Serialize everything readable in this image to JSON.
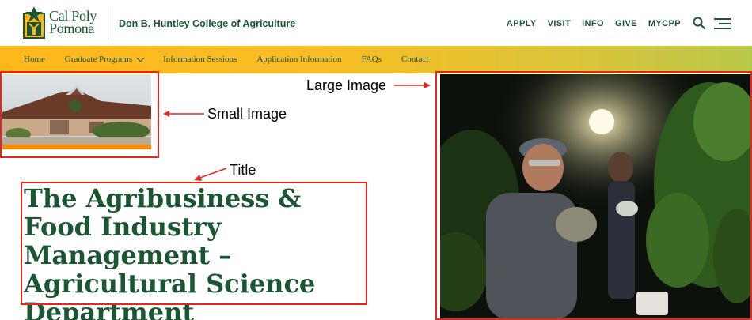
{
  "header": {
    "logo_line1": "Cal Poly",
    "logo_line2": "Pomona",
    "college_name": "Don B. Huntley College of Agriculture",
    "util_links": [
      "APPLY",
      "VISIT",
      "INFO",
      "GIVE",
      "MYCPP"
    ],
    "icons": [
      "search-icon",
      "menu-icon"
    ]
  },
  "nav": {
    "items": [
      "Home",
      "Graduate Programs",
      "Information Sessions",
      "Application Information",
      "FAQs",
      "Contact"
    ]
  },
  "title": "The Agribusiness & Food Industry Management – Agricultural Science Department",
  "annotations": {
    "small_image": "Small Image",
    "large_image": "Large Image",
    "title": "Title"
  },
  "colors": {
    "brand_green": "#1a5632",
    "nav_gold": "#ffb81c",
    "nav_lime": "#b8c94a",
    "accent_orange": "#ff8a00",
    "annotation_red": "#e8251c"
  }
}
